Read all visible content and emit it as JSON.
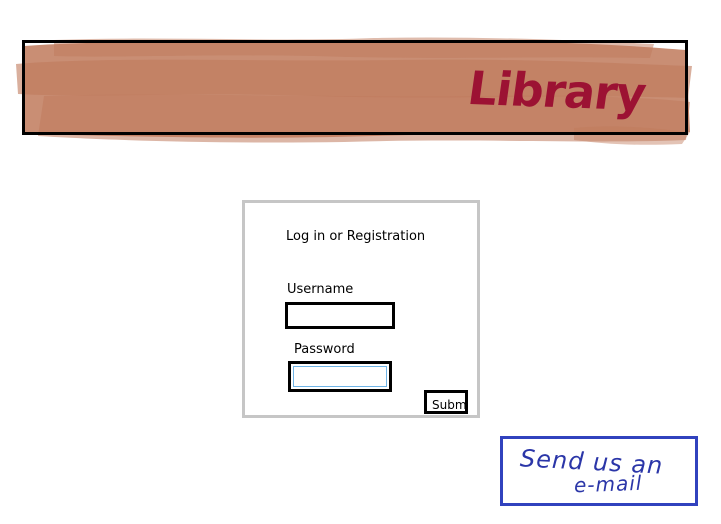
{
  "header": {
    "title": "Library"
  },
  "login": {
    "heading": "Log in or Registration",
    "username_label": "Username",
    "username_value": "",
    "password_label": "Password",
    "password_value": "",
    "submit_label": "Submit"
  },
  "contact": {
    "line1": "Send us an",
    "line2": "e-mail"
  },
  "colors": {
    "banner_paint": "#c07a5c",
    "banner_title": "#9c1233",
    "login_border": "#c6c6c6",
    "email_border": "#3142be",
    "email_text": "#2b36a8"
  }
}
